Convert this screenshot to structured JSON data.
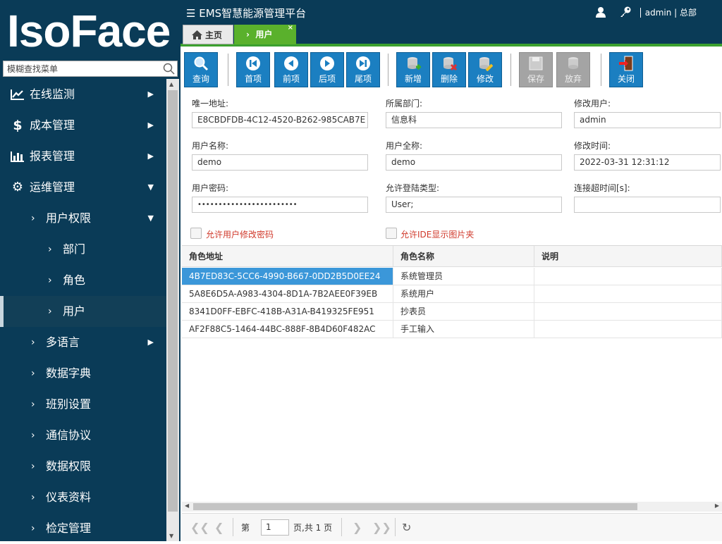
{
  "app": {
    "logo": "IsoFace",
    "title": "EMS智慧能源管理平台",
    "user": "admin | 总部"
  },
  "search": {
    "placeholder": "模糊查找菜单"
  },
  "menu": [
    {
      "label": "在线监测",
      "icon": "chart-line-icon",
      "level": 0,
      "arrow": "▶"
    },
    {
      "label": "成本管理",
      "icon": "dollar-icon",
      "level": 0,
      "arrow": "▶"
    },
    {
      "label": "报表管理",
      "icon": "bar-chart-icon",
      "level": 0,
      "arrow": "▶"
    },
    {
      "label": "运维管理",
      "icon": "gear-icon",
      "level": 0,
      "arrow": "▼"
    },
    {
      "label": "用户权限",
      "level": 1,
      "arrow": "▼"
    },
    {
      "label": "部门",
      "level": 2,
      "arrow": ""
    },
    {
      "label": "角色",
      "level": 2,
      "arrow": ""
    },
    {
      "label": "用户",
      "level": 2,
      "arrow": "",
      "active": true
    },
    {
      "label": "多语言",
      "level": 1,
      "arrow": "▶"
    },
    {
      "label": "数据字典",
      "level": 1,
      "arrow": ""
    },
    {
      "label": "班别设置",
      "level": 1,
      "arrow": ""
    },
    {
      "label": "通信协议",
      "level": 1,
      "arrow": ""
    },
    {
      "label": "数据权限",
      "level": 1,
      "arrow": ""
    },
    {
      "label": "仪表资料",
      "level": 1,
      "arrow": ""
    },
    {
      "label": "检定管理",
      "level": 1,
      "arrow": ""
    }
  ],
  "tabs": {
    "home": "主页",
    "current": "用户",
    "close": "×"
  },
  "toolbar": [
    {
      "label": "查询",
      "icon": "search-icon",
      "enabled": true
    },
    {
      "label": "首项",
      "icon": "first-icon",
      "enabled": true
    },
    {
      "label": "前项",
      "icon": "prev-icon",
      "enabled": true
    },
    {
      "label": "后项",
      "icon": "next-icon",
      "enabled": true
    },
    {
      "label": "尾项",
      "icon": "last-icon",
      "enabled": true
    },
    {
      "label": "新增",
      "icon": "add-icon",
      "enabled": true
    },
    {
      "label": "删除",
      "icon": "delete-icon",
      "enabled": true
    },
    {
      "label": "修改",
      "icon": "edit-icon",
      "enabled": true
    },
    {
      "label": "保存",
      "icon": "save-icon",
      "enabled": false
    },
    {
      "label": "放弃",
      "icon": "discard-icon",
      "enabled": false
    },
    {
      "label": "关闭",
      "icon": "exit-icon",
      "enabled": true
    }
  ],
  "form": {
    "uid_label": "唯一地址:",
    "uid": "E8CBDFDB-4C12-4520-B262-985CAB7E",
    "dept_label": "所属部门:",
    "dept": "信息科",
    "moduser_label": "修改用户:",
    "moduser": "admin",
    "uname_label": "用户名称:",
    "uname": "demo",
    "ufull_label": "用户全称:",
    "ufull": "demo",
    "modtime_label": "修改时间:",
    "modtime": "2022-03-31 12:31:12",
    "pwd_label": "用户密码:",
    "pwd": "••••••••••••••••••••••••",
    "logintype_label": "允许登陆类型:",
    "logintype": "User;",
    "timeout_label": "连接超时间[s]:",
    "timeout": "",
    "check1": "允许用户修改密码",
    "check2": "允许IDE显示图片夹"
  },
  "grid": {
    "headers": [
      "角色地址",
      "角色名称",
      "说明"
    ],
    "rows": [
      [
        "4B7ED83C-5CC6-4990-B667-0DD2B5D0EE24",
        "系统管理员",
        ""
      ],
      [
        "5A8E6D5A-A983-4304-8D1A-7B2AEE0F39EB",
        "系统用户",
        ""
      ],
      [
        "8341D0FF-EBFC-418B-A31A-B419325FE951",
        "抄表员",
        ""
      ],
      [
        "AF2F88C5-1464-44BC-888F-8B4D60F482AC",
        "手工输入",
        ""
      ]
    ],
    "selected": 0
  },
  "pager": {
    "page_prefix": "第",
    "page": "1",
    "page_suffix": "页,共 1 页"
  }
}
